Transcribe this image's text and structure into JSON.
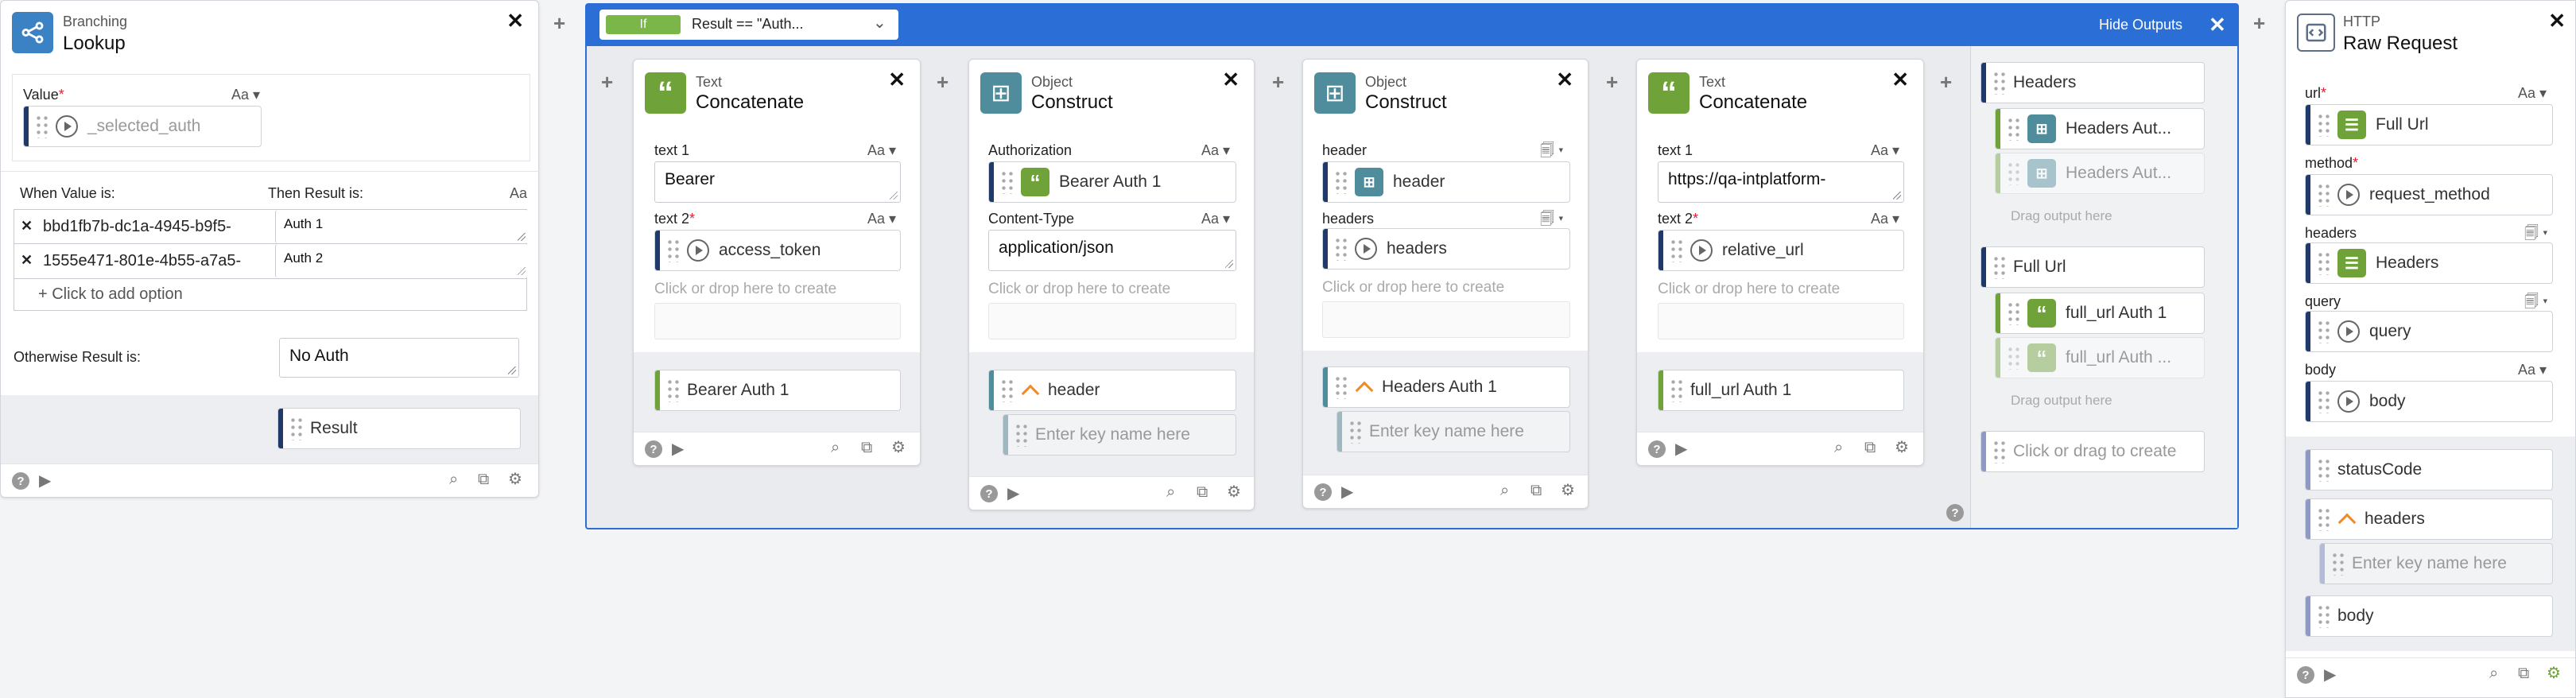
{
  "lookup": {
    "type": "Branching",
    "name": "Lookup",
    "value_label": "Value",
    "value_input": "_selected_auth",
    "aa": "Aa",
    "when_label": "When Value is:",
    "then_label": "Then Result is:",
    "rows": [
      {
        "when": "bbd1fb7b-dc1a-4945-b9f5-",
        "then": "Auth 1"
      },
      {
        "when": "1555e471-801e-4b55-a7a5-",
        "then": "Auth 2"
      }
    ],
    "add_option": "+ Click to add option",
    "otherwise_label": "Otherwise Result is:",
    "otherwise_value": "No Auth",
    "output": "Result"
  },
  "if_bar": {
    "badge": "If",
    "condition": "Result == \"Auth...",
    "hide_outputs": "Hide Outputs"
  },
  "concat1": {
    "type": "Text",
    "name": "Concatenate",
    "text1_label": "text 1",
    "text1_value": "Bearer",
    "text2_label": "text 2",
    "text2_value": "access_token",
    "create_hint": "Click or drop here to create",
    "output": "Bearer Auth 1"
  },
  "construct1": {
    "type": "Object",
    "name": "Construct",
    "f1_label": "Authorization",
    "f1_value": "Bearer Auth 1",
    "f2_label": "Content-Type",
    "f2_value": "application/json",
    "create_hint": "Click or drop here to create",
    "output": "header",
    "key_placeholder": "Enter key name here"
  },
  "construct2": {
    "type": "Object",
    "name": "Construct",
    "f1_label": "header",
    "f1_value": "header",
    "f2_label": "headers",
    "f2_value": "headers",
    "create_hint": "Click or drop here to create",
    "output": "Headers Auth 1",
    "key_placeholder": "Enter key name here"
  },
  "concat2": {
    "type": "Text",
    "name": "Concatenate",
    "text1_label": "text 1",
    "text1_value": "https://qa-intplatform-",
    "text2_label": "text 2",
    "text2_value": "relative_url",
    "create_hint": "Click or drop here to create",
    "output": "full_url Auth 1"
  },
  "outputs_panel": {
    "g1_title": "Headers",
    "g1_items": [
      "Headers Aut...",
      "Headers Aut..."
    ],
    "g1_drag": "Drag output here",
    "g2_title": "Full Url",
    "g2_items": [
      "full_url Auth 1",
      "full_url Auth ..."
    ],
    "g2_drag": "Drag output here",
    "create": "Click or drag to create"
  },
  "http": {
    "type": "HTTP",
    "name": "Raw Request",
    "url_label": "url",
    "url_value": "Full Url",
    "method_label": "method",
    "method_value": "request_method",
    "headers_label": "headers",
    "headers_value": "Headers",
    "query_label": "query",
    "query_value": "query",
    "body_label": "body",
    "body_value": "body",
    "outputs": [
      "statusCode",
      "headers",
      "body"
    ],
    "key_placeholder": "Enter key name here"
  },
  "colors": {
    "navy": "#1f3a68",
    "blue": "#2b6fd6",
    "teal": "#4f8c9c",
    "green": "#6fa33a",
    "lookup_icon": "#3b82c4",
    "http_icon": "#5c6f86",
    "output_bar": "#8e99c4",
    "if_badge": "#7ab648"
  }
}
